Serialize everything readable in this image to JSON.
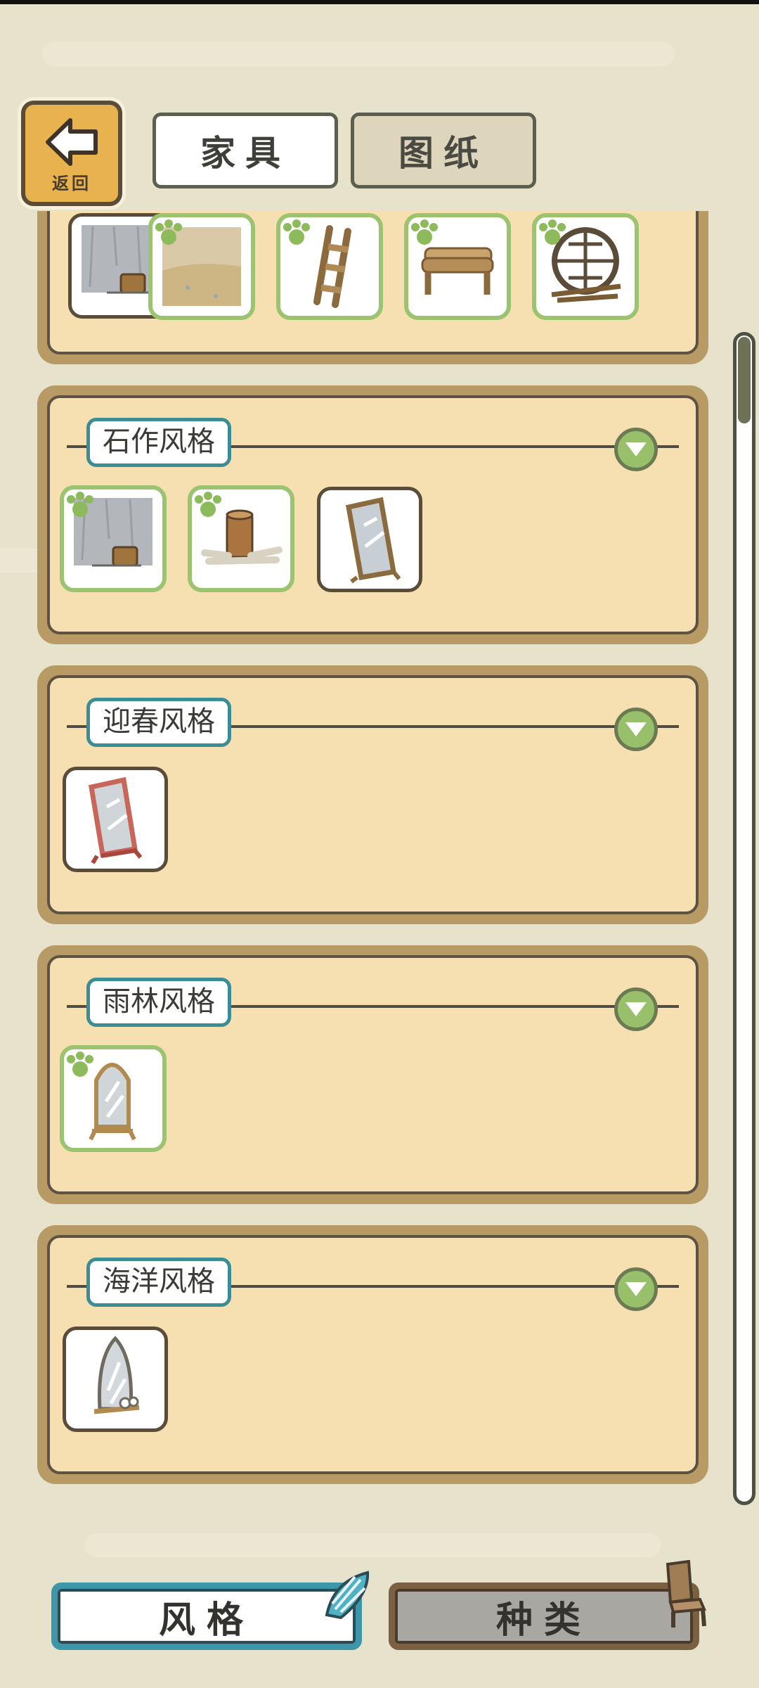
{
  "header": {
    "back_label": "返回",
    "tabs": [
      {
        "label": "家具",
        "active": true
      },
      {
        "label": "图纸",
        "active": false
      }
    ]
  },
  "sections": [
    {
      "title": "",
      "collapsed": false,
      "items": [
        {
          "icon": "stone-wall-bucket-icon",
          "owned": false
        },
        {
          "icon": "sand-floor-icon",
          "owned": true
        },
        {
          "icon": "wooden-ladder-icon",
          "owned": true
        },
        {
          "icon": "log-bench-icon",
          "owned": true
        },
        {
          "icon": "round-window-icon",
          "owned": true
        }
      ]
    },
    {
      "title": "石作风格",
      "collapsed": false,
      "items": [
        {
          "icon": "stone-wall-bucket-icon",
          "owned": true
        },
        {
          "icon": "stump-logs-icon",
          "owned": true
        },
        {
          "icon": "wooden-mirror-icon",
          "owned": false
        }
      ]
    },
    {
      "title": "迎春风格",
      "collapsed": false,
      "items": [
        {
          "icon": "red-mirror-icon",
          "owned": false
        }
      ]
    },
    {
      "title": "雨林风格",
      "collapsed": false,
      "items": [
        {
          "icon": "arched-mirror-icon",
          "owned": true
        }
      ]
    },
    {
      "title": "海洋风格",
      "collapsed": false,
      "items": [
        {
          "icon": "shell-mirror-icon",
          "owned": false
        }
      ]
    }
  ],
  "footer": {
    "style_label": "风格",
    "kind_label": "种类",
    "active": "风格"
  },
  "colors": {
    "background": "#e6e2cb",
    "panel": "#f6dfb0",
    "panel_frame": "#b79a64",
    "accent_teal": "#3a8d94",
    "owned_green": "#9cc36f"
  }
}
